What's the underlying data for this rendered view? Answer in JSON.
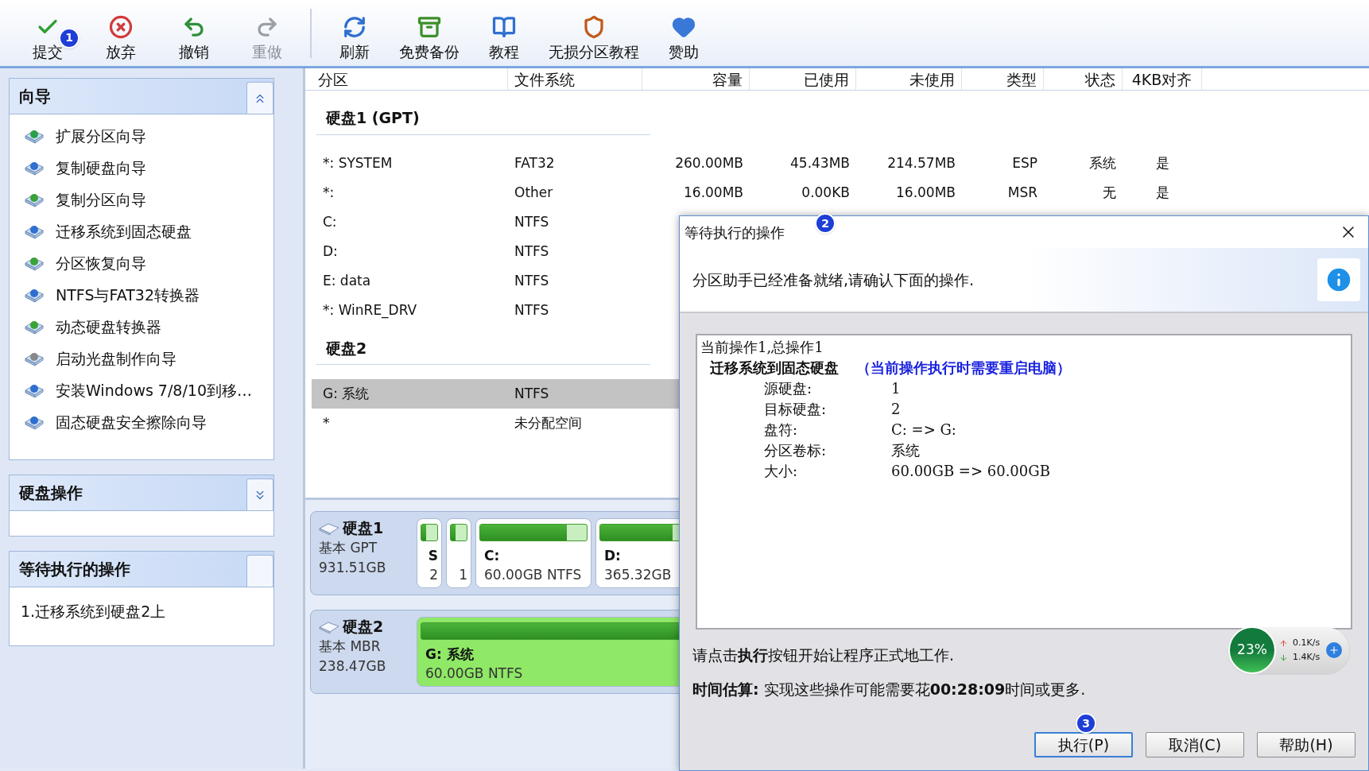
{
  "toolbar": [
    {
      "label": "提交",
      "disabled": false,
      "badge": "1"
    },
    {
      "label": "放弃",
      "disabled": false
    },
    {
      "label": "撤销",
      "disabled": false
    },
    {
      "label": "重做",
      "disabled": true
    },
    {
      "label": "刷新",
      "disabled": false,
      "separator_before": true
    },
    {
      "label": "免费备份",
      "disabled": false
    },
    {
      "label": "教程",
      "disabled": false
    },
    {
      "label": "无损分区教程",
      "disabled": false
    },
    {
      "label": "赞助",
      "disabled": false
    }
  ],
  "sidebar": {
    "panels": [
      {
        "title": "向导",
        "expanded": true,
        "items": [
          "扩展分区向导",
          "复制硬盘向导",
          "复制分区向导",
          "迁移系统到固态硬盘",
          "分区恢复向导",
          "NTFS与FAT32转换器",
          "动态硬盘转换器",
          "启动光盘制作向导",
          "安装Windows 7/8/10到移…",
          "固态硬盘安全擦除向导"
        ]
      },
      {
        "title": "硬盘操作",
        "expanded": false
      },
      {
        "title": "等待执行的操作",
        "items": [
          "1.迁移系统到硬盘2上"
        ]
      }
    ]
  },
  "table": {
    "columns": [
      "分区",
      "文件系统",
      "容量",
      "已使用",
      "未使用",
      "类型",
      "状态",
      "4KB对齐"
    ],
    "groups": [
      {
        "title": "硬盘1 (GPT)",
        "rows": [
          {
            "cells": [
              "*: SYSTEM",
              "FAT32",
              "260.00MB",
              "45.43MB",
              "214.57MB",
              "ESP",
              "系统",
              "是"
            ],
            "selected": false
          },
          {
            "cells": [
              "*:",
              "Other",
              "16.00MB",
              "0.00KB",
              "16.00MB",
              "MSR",
              "无",
              "是"
            ],
            "selected": false
          },
          {
            "cells": [
              "C:",
              "NTFS"
            ],
            "selected": false
          },
          {
            "cells": [
              "D:",
              "NTFS"
            ],
            "selected": false
          },
          {
            "cells": [
              "E: data",
              "NTFS"
            ],
            "selected": false
          },
          {
            "cells": [
              "*: WinRE_DRV",
              "NTFS"
            ],
            "selected": false
          }
        ]
      },
      {
        "title": "硬盘2",
        "rows": [
          {
            "cells": [
              "G: 系统",
              "NTFS"
            ],
            "selected": true
          },
          {
            "cells": [
              "*",
              "未分配空间"
            ],
            "selected": false
          }
        ]
      }
    ]
  },
  "disk_map": [
    {
      "name": "硬盘1",
      "style": "基本 GPT",
      "size": "931.51GB",
      "partitions": [
        {
          "kind": "narrow",
          "label": "S",
          "detail": "2",
          "level": 0.3,
          "selected": false
        },
        {
          "kind": "narrow",
          "detail": "1",
          "level": 0.3,
          "selected": false
        },
        {
          "kind": "wide",
          "label": "C:",
          "detail": "60.00GB NTFS",
          "level": 0.81,
          "selected": false
        },
        {
          "kind": "wide",
          "label": "D:",
          "detail": "365.32GB",
          "level": 0.68,
          "selected": false
        }
      ]
    },
    {
      "name": "硬盘2",
      "style": "基本 MBR",
      "size": "238.47GB",
      "partitions": [
        {
          "kind": "full",
          "label": "G: 系统",
          "detail": "60.00GB NTFS",
          "selected": true
        }
      ]
    }
  ],
  "dialog": {
    "title": "等待执行的操作",
    "badge": "2",
    "message": "分区助手已经准备就绪,请确认下面的操作.",
    "summary": "当前操作1,总操作1",
    "operation": "迁移系统到固态硬盘",
    "note": "（当前操作执行时需要重启电脑）",
    "details": [
      {
        "label": "源硬盘:",
        "value": "1"
      },
      {
        "label": "目标硬盘:",
        "value": "2"
      },
      {
        "label": "盘符:",
        "value": "C: => G:"
      },
      {
        "label": "分区卷标:",
        "value": "系统"
      },
      {
        "label": "大小:",
        "value": "60.00GB => 60.00GB"
      }
    ],
    "instruction": "请点击**执行**按钮开始让程序正式地工作.",
    "estimate": "**时间估算:** 实现这些操作可能需要花**00:28:09**时间或更多.",
    "buttons": [
      {
        "label": "执行(P)",
        "default": true,
        "badge": "3"
      },
      {
        "label": "取消(C)",
        "default": false
      },
      {
        "label": "帮助(H)",
        "default": false
      }
    ]
  },
  "speed_widget": {
    "percent": "23%",
    "upload": "0.1K/s",
    "download": "1.4K/s"
  }
}
